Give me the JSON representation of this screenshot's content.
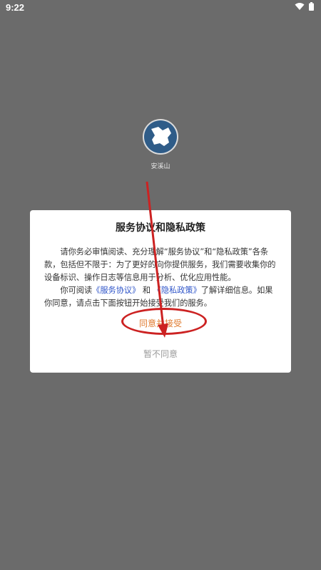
{
  "status_bar": {
    "time": "9:22",
    "wifi_icon": "wifi-icon",
    "battery_icon": "battery-icon"
  },
  "app": {
    "name": "安溪山",
    "logo_icon": "map-logo-icon"
  },
  "dialog": {
    "title": "服务协议和隐私政策",
    "paragraph1": "请你务必审慎阅读、充分理解“服务协议”和“隐私政策”各条款，包括但不限于：为了更好的向你提供服务，我们需要收集你的设备标识、操作日志等信息用于分析、优化应用性能。",
    "paragraph2_prefix": "你可阅读",
    "service_link": "《服务协议》",
    "and_text": "和",
    "privacy_link": "《隐私政策》",
    "paragraph2_suffix": "了解详细信息。如果你同意，请点击下面按钮开始接受我们的服务。",
    "accept_label": "同意并接受",
    "decline_label": "暂不同意"
  },
  "colors": {
    "overlay_background": "#6b6b6b",
    "accent": "#e07a2e",
    "link": "#2f55c9",
    "annotation": "#cc2222"
  }
}
